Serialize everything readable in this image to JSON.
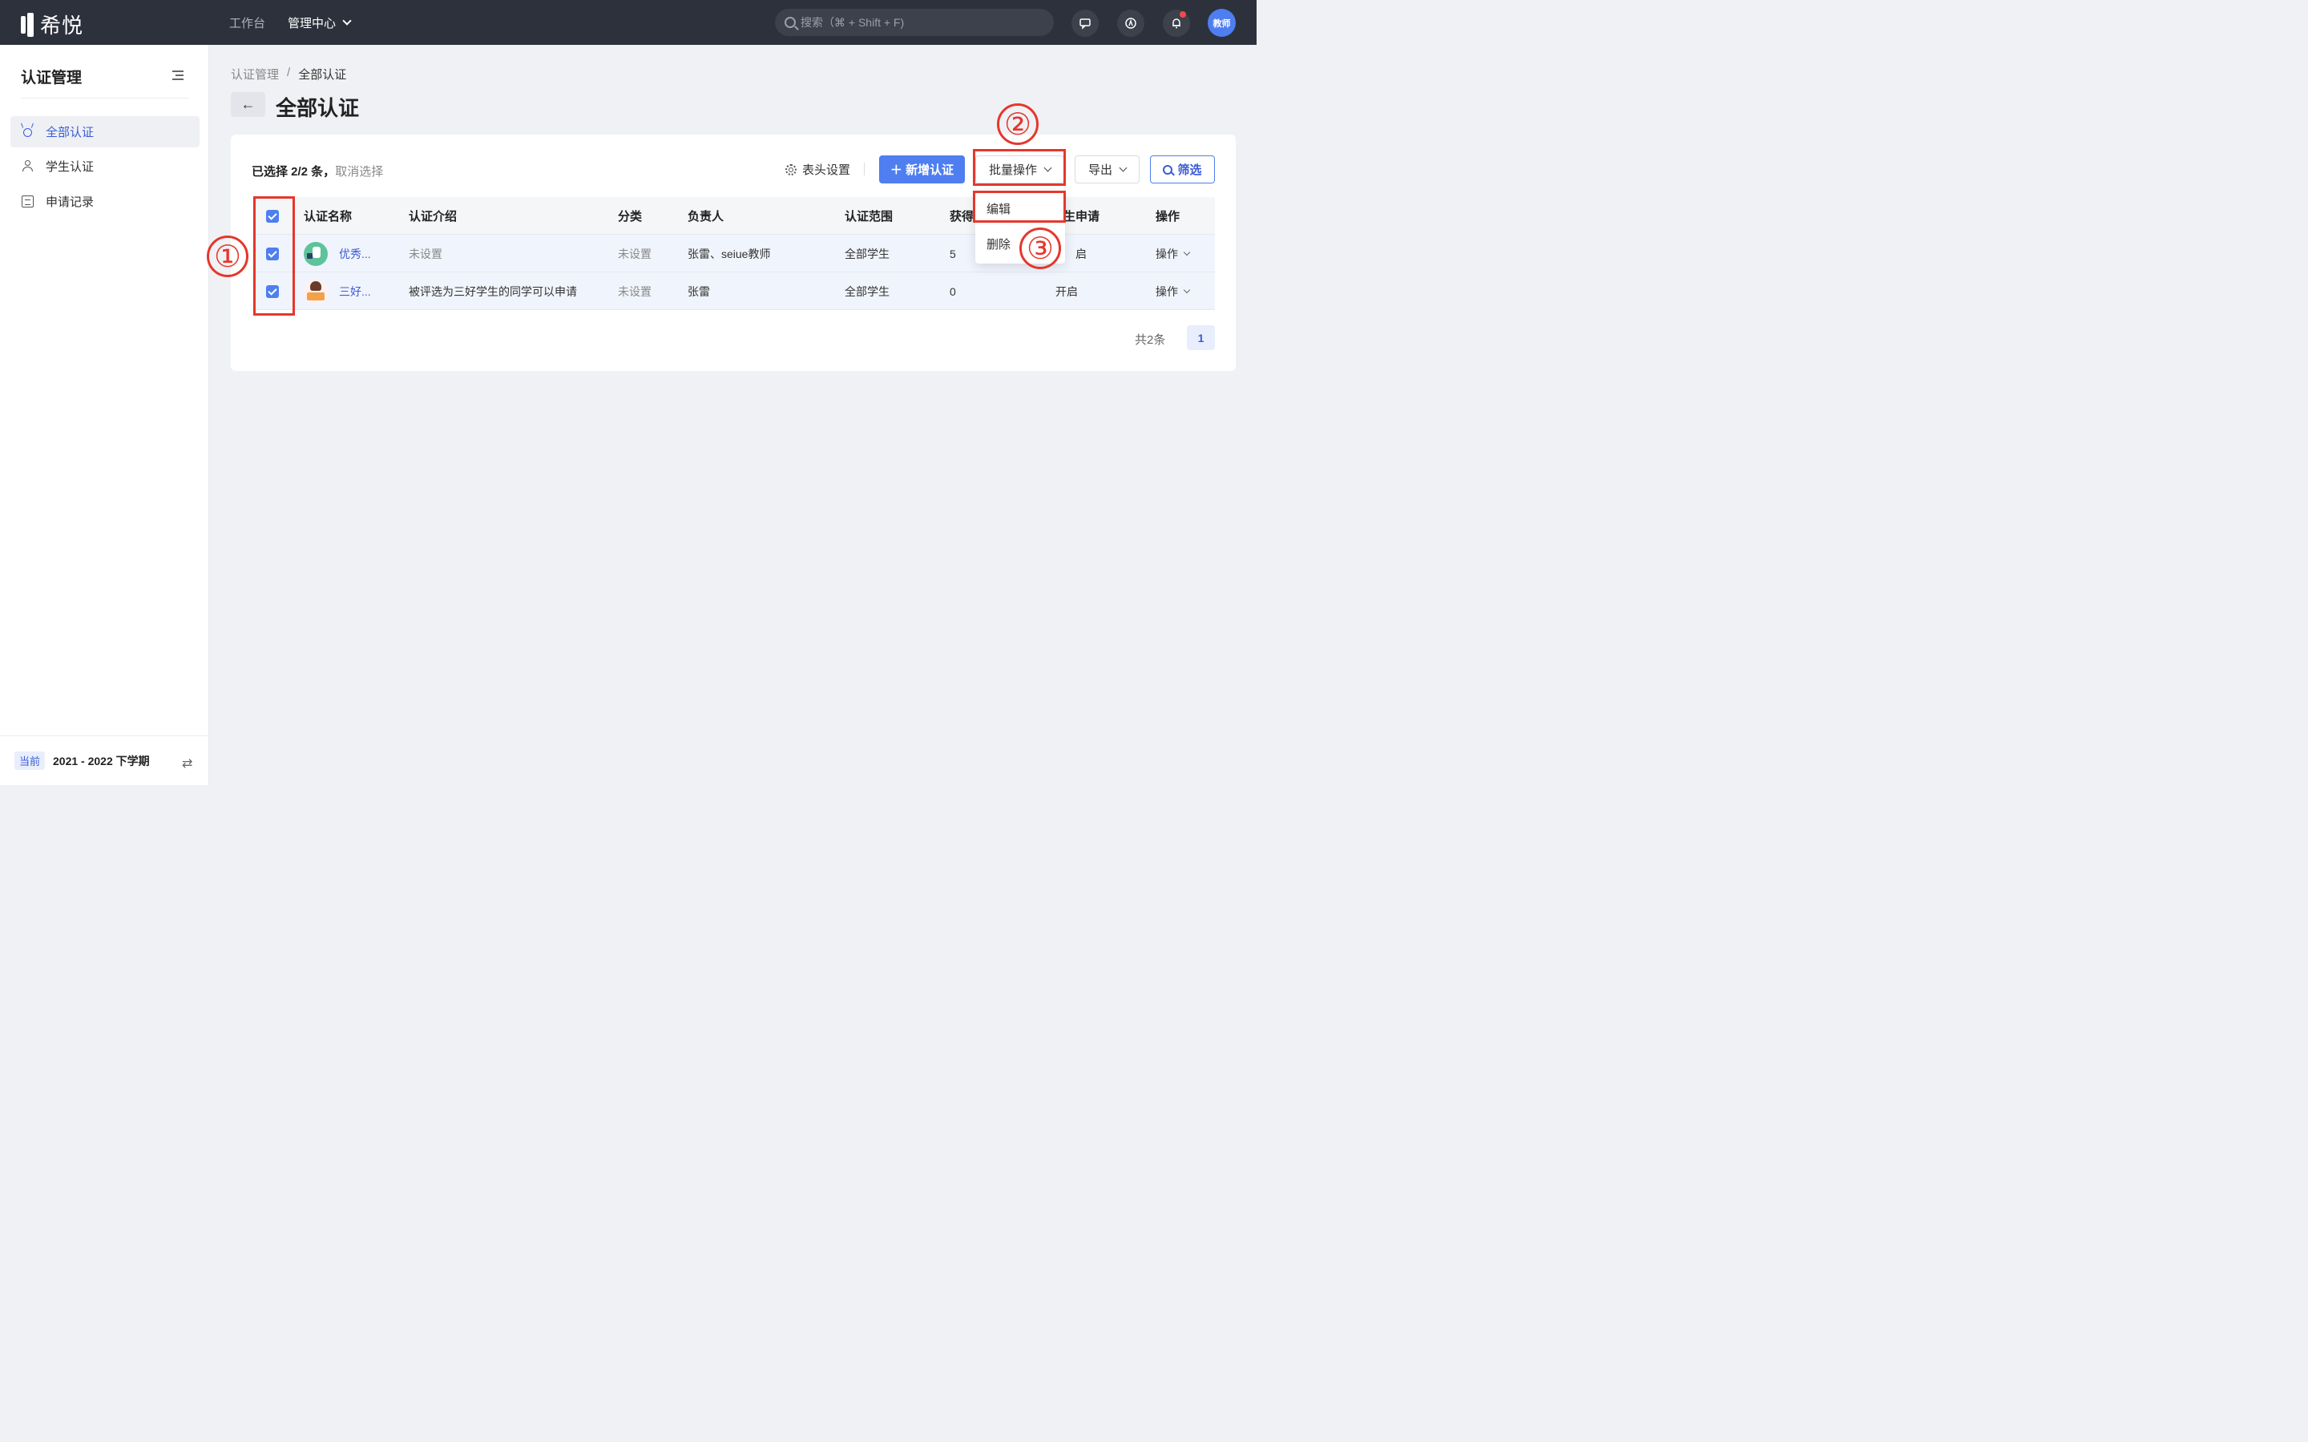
{
  "topbar": {
    "logo_text": "希悦",
    "nav": [
      {
        "label": "工作台"
      },
      {
        "label": "管理中心"
      }
    ],
    "search_placeholder": "搜索（⌘ + Shift + F)",
    "avatar_text": "教师"
  },
  "sidebar": {
    "title": "认证管理",
    "items": [
      {
        "label": "全部认证"
      },
      {
        "label": "学生认证"
      },
      {
        "label": "申请记录"
      }
    ],
    "footer": {
      "badge": "当前",
      "term": "2021 - 2022 下学期",
      "swap_glyph": "⇄"
    }
  },
  "main": {
    "breadcrumb": {
      "parent": "认证管理",
      "sep": "/",
      "current": "全部认证"
    },
    "back_glyph": "←",
    "title": "全部认证",
    "selection": {
      "text": "已选择 2/2 条，",
      "cancel": "取消选择"
    },
    "toolbar": {
      "header_settings": "表头设置",
      "add_label": "＋ 新增认证",
      "batch_label": "批量操作",
      "export_label": "导出",
      "filter_label": "筛选"
    },
    "batch_menu": [
      {
        "label": "编辑"
      },
      {
        "label": "删除"
      }
    ],
    "table": {
      "columns": [
        "认证名称",
        "认证介绍",
        "分类",
        "负责人",
        "认证范围",
        "获得",
        "生申请",
        "操作"
      ],
      "rows": [
        {
          "name": "优秀...",
          "intro": "未设置",
          "category": "未设置",
          "owner": "张雷、seiue教师",
          "scope": "全部学生",
          "count": "5",
          "apply": "启",
          "action": "操作"
        },
        {
          "name": "三好...",
          "intro": "被评选为三好学生的同学可以申请",
          "category": "未设置",
          "owner": "张雷",
          "scope": "全部学生",
          "count": "0",
          "apply": "开启",
          "action": "操作"
        }
      ]
    },
    "pagination": {
      "total": "共2条",
      "current_page": "1"
    }
  },
  "annotations": [
    "①",
    "②",
    "③"
  ],
  "colors": {
    "accent": "#4e7ef0",
    "topbar": "#2c313c",
    "annotation": "#e5372c"
  }
}
